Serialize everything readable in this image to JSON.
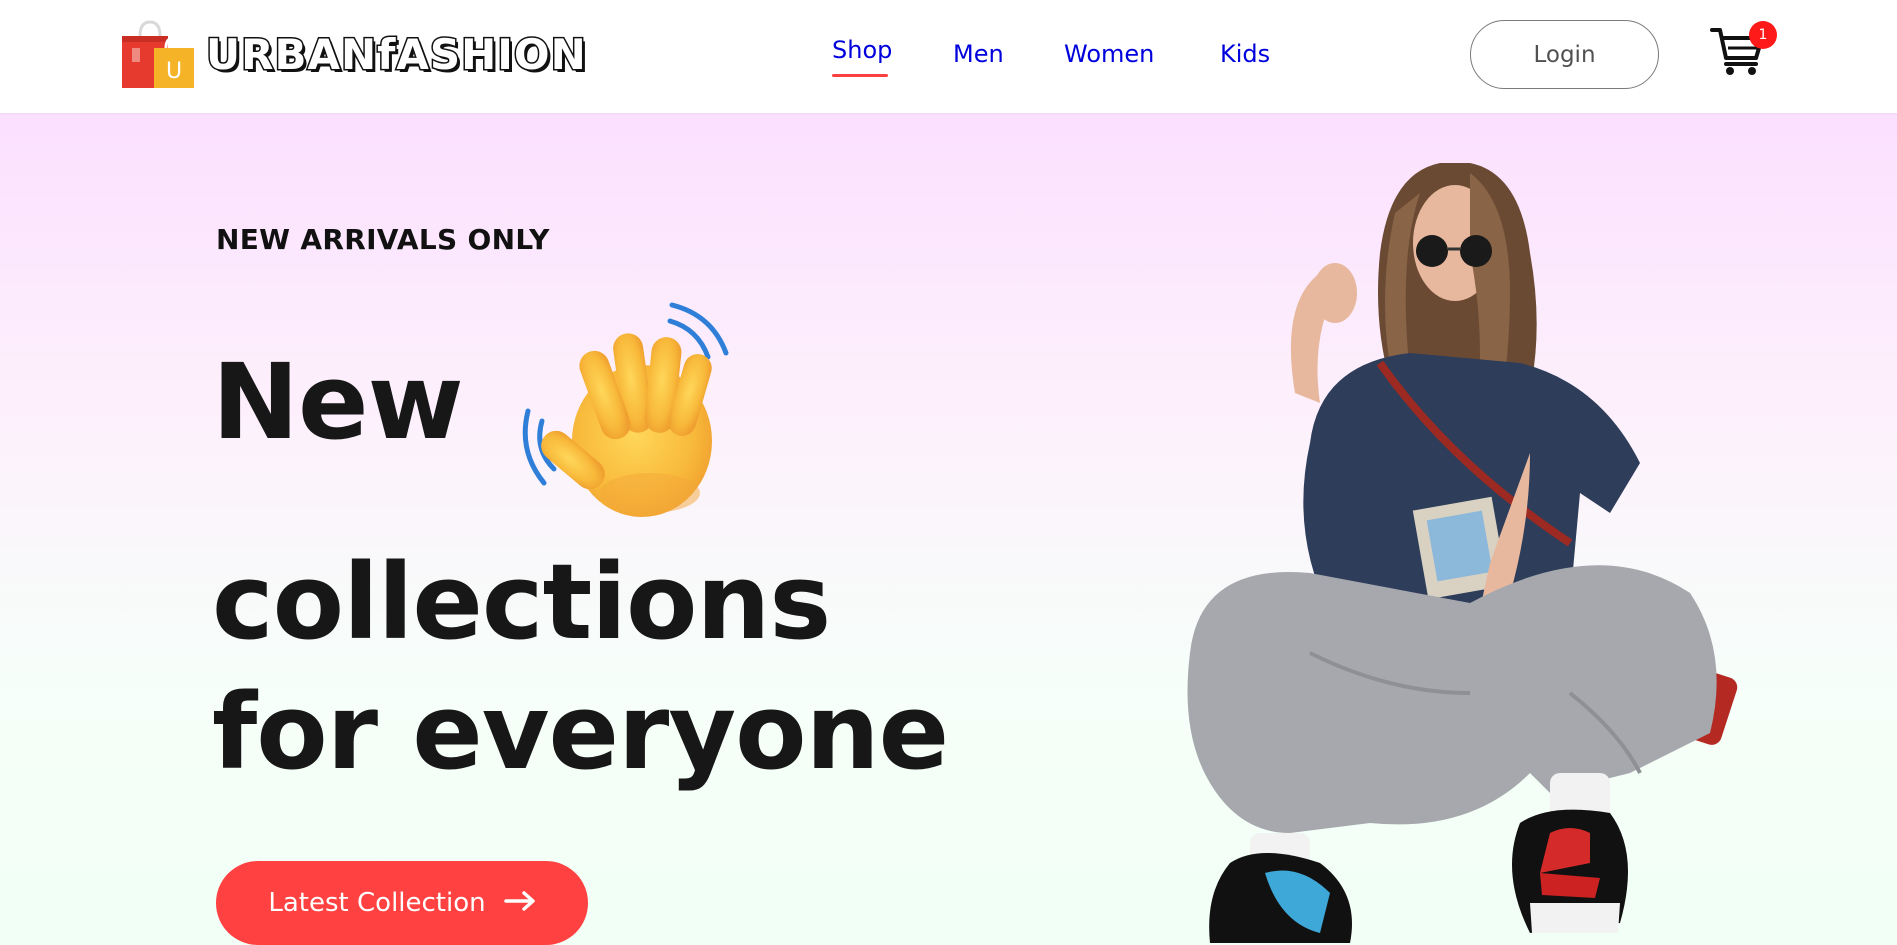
{
  "navbar": {
    "logo_text": "URBANfASHION",
    "logo_bag_letter": "U",
    "links": [
      {
        "label": "Shop",
        "active": true
      },
      {
        "label": "Men",
        "active": false
      },
      {
        "label": "Women",
        "active": false
      },
      {
        "label": "Kids",
        "active": false
      }
    ],
    "login_label": "Login",
    "cart_count": "1"
  },
  "hero": {
    "tagline": "NEW ARRIVALS ONLY",
    "headline": [
      "New",
      "collections",
      "for everyone"
    ],
    "cta_label": "Latest Collection"
  },
  "colors": {
    "accent": "#ff4141",
    "nav_link": "#0000dd",
    "heading": "#171717",
    "hero_top": "#fbe0ff",
    "hero_bottom": "#f1fff6"
  },
  "icons": {
    "logo": "shopping-bag-icon",
    "cart": "cart-icon",
    "wave": "waving-hand-icon",
    "cta_arrow": "arrow-right-icon"
  }
}
